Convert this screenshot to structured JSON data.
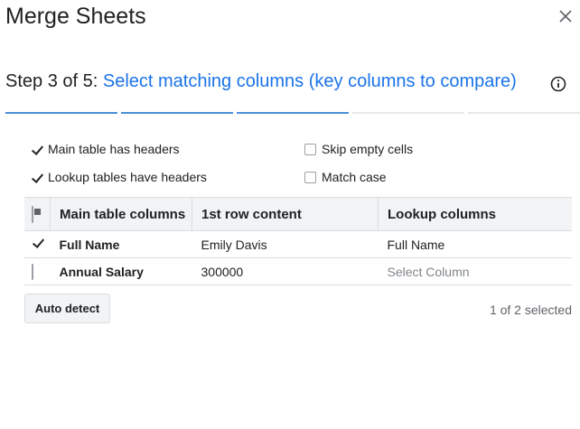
{
  "dialog": {
    "title": "Merge Sheets",
    "close_icon": "close-icon"
  },
  "step": {
    "prefix": "Step 3 of 5:",
    "text": "Select matching columns (key columns to compare)",
    "info_icon": "info-icon",
    "progress": {
      "current": 3,
      "total": 5
    }
  },
  "options": {
    "main_headers": {
      "label": "Main table has headers",
      "checked": true
    },
    "lookup_headers": {
      "label": "Lookup tables have headers",
      "checked": true
    },
    "skip_empty": {
      "label": "Skip empty cells",
      "checked": false
    },
    "match_case": {
      "label": "Match case",
      "checked": false
    }
  },
  "table": {
    "headers": [
      "Main table columns",
      "1st row content",
      "Lookup columns"
    ],
    "rows": [
      {
        "checked": true,
        "column": "Full Name",
        "first_row": "Emily Davis",
        "lookup": "Full Name",
        "lookup_is_placeholder": false
      },
      {
        "checked": false,
        "column": "Annual Salary",
        "first_row": "300000",
        "lookup": "Select Column",
        "lookup_is_placeholder": true
      }
    ]
  },
  "footer": {
    "auto_detect_label": "Auto detect",
    "selected_count": "1 of 2 selected"
  },
  "colors": {
    "accent": "#1a73e8",
    "progress_done": "#4a90d9",
    "progress_todo": "#e8e8e8",
    "header_bg": "#f1f3f4"
  }
}
